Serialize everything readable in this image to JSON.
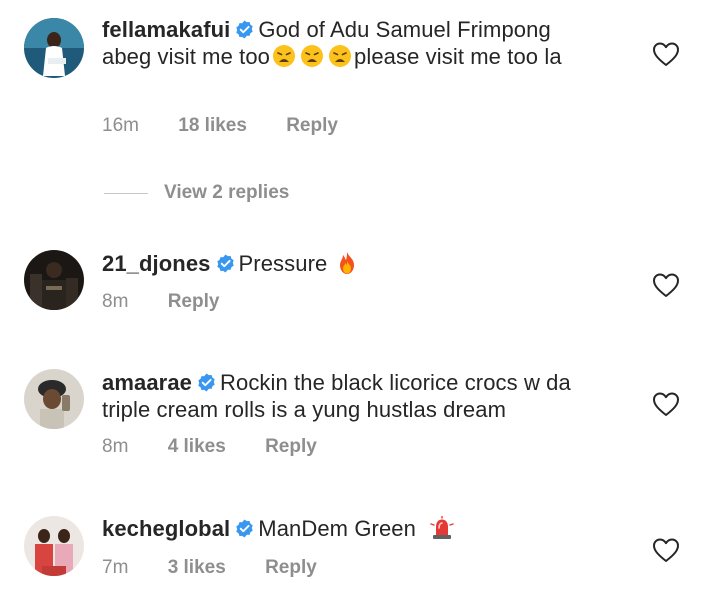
{
  "comments": [
    {
      "username": "fellamakafui",
      "text_a": "God of Adu Samuel Frimpong abeg visit me too",
      "text_b": "please visit me too la",
      "emojis": [
        "weary-face-emoji",
        "weary-face-emoji",
        "weary-face-emoji"
      ],
      "time": "16m",
      "likes": "18 likes",
      "reply": "Reply"
    },
    {
      "username": "21_djones",
      "text": "Pressure",
      "emojis": [
        "fire-emoji"
      ],
      "time": "8m",
      "reply": "Reply"
    },
    {
      "username": "amaarae",
      "text": "Rockin the black licorice crocs w da triple cream rolls is a yung hustlas dream",
      "time": "8m",
      "likes": "4 likes",
      "reply": "Reply"
    },
    {
      "username": "kecheglobal",
      "text": "ManDem Green",
      "emojis": [
        "police-light-emoji"
      ],
      "time": "7m",
      "likes": "3 likes",
      "reply": "Reply"
    }
  ],
  "view_replies": "View 2 replies",
  "colors": {
    "text": "#262626",
    "meta": "#8e8e8e",
    "verified": "#3897f0"
  }
}
